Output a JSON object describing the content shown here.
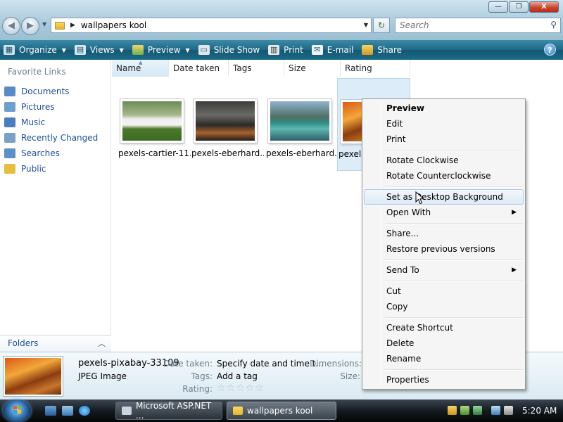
{
  "window": {
    "minimize_glyph": "—",
    "maximize_glyph": "❐",
    "close_glyph": "X"
  },
  "address": {
    "path": "wallpapers kool",
    "search_placeholder": "Search"
  },
  "toolbar": {
    "organize": "Organize",
    "views": "Views",
    "preview": "Preview",
    "slideshow": "Slide Show",
    "print": "Print",
    "email": "E-mail",
    "share": "Share",
    "help": "?"
  },
  "nav": {
    "favorites_title": "Favorite Links",
    "items": [
      {
        "label": "Documents",
        "icon": "documents-icon",
        "color": "#5b8bc6"
      },
      {
        "label": "Pictures",
        "icon": "pictures-icon",
        "color": "#6e9fce"
      },
      {
        "label": "Music",
        "icon": "music-icon",
        "color": "#4a7cc0"
      },
      {
        "label": "Recently Changed",
        "icon": "recent-icon",
        "color": "#7aa0c8"
      },
      {
        "label": "Searches",
        "icon": "searches-icon",
        "color": "#5d8fc9"
      },
      {
        "label": "Public",
        "icon": "public-folder-icon",
        "color": "#e7bd3e"
      }
    ],
    "folders_label": "Folders"
  },
  "columns": [
    "Name",
    "Date taken",
    "Tags",
    "Size",
    "Rating"
  ],
  "files": [
    {
      "label": "pexels-cartier-11..."
    },
    {
      "label": "pexels-eberhard..."
    },
    {
      "label": "pexels-eberhard..."
    },
    {
      "label": "pexels"
    }
  ],
  "details": {
    "name": "pexels-pixabay-33109",
    "type": "JPEG Image",
    "date_key": "Date taken:",
    "date_val": "Specify date and time t...",
    "tags_key": "Tags:",
    "tags_val": "Add a tag",
    "rating_key": "Rating:",
    "rating_stars": "☆☆☆☆☆",
    "dimensions_key": "Dimensions:",
    "size_key": "Size:"
  },
  "context_menu": {
    "preview": "Preview",
    "edit": "Edit",
    "print": "Print",
    "rotate_cw": "Rotate Clockwise",
    "rotate_ccw": "Rotate Counterclockwise",
    "set_bg": "Set as Desktop Background",
    "open_with": "Open With",
    "share": "Share...",
    "restore": "Restore previous versions",
    "send_to": "Send To",
    "cut": "Cut",
    "copy": "Copy",
    "create_shortcut": "Create Shortcut",
    "delete": "Delete",
    "rename": "Rename",
    "properties": "Properties"
  },
  "taskbar": {
    "task1": "Microsoft ASP.NET ...",
    "task2": "wallpapers kool",
    "clock": "5:20 AM"
  }
}
